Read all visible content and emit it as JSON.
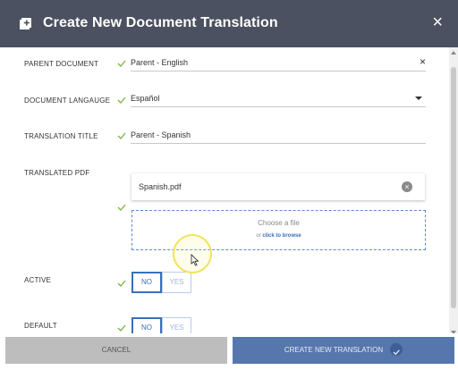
{
  "dialog": {
    "title": "Create New Document Translation",
    "close_label": "×"
  },
  "form": {
    "parent_document": {
      "label": "PARENT DOCUMENT",
      "value": "Parent - English",
      "clear": "×"
    },
    "document_language": {
      "label": "DOCUMENT LANGAUGE",
      "value": "Español"
    },
    "translation_title": {
      "label": "TRANSLATION TITLE",
      "value": "Parent - Spanish"
    },
    "translated_pdf": {
      "label": "TRANSLATED PDF",
      "file_name": "Spanish.pdf",
      "remove": "×",
      "drop_text": "Choose a file",
      "drop_or": "or ",
      "drop_browse": "click to browse"
    },
    "active": {
      "label": "ACTIVE",
      "options": [
        "NO",
        "YES"
      ],
      "selected": "NO"
    },
    "default": {
      "label": "DEFAULT",
      "options": [
        "NO",
        "YES"
      ],
      "selected": "NO"
    }
  },
  "footer": {
    "cancel_label": "CANCEL",
    "create_label": "CREATE NEW TRANSLATION"
  },
  "colors": {
    "header_bg": "#4b5160",
    "accent": "#3a6fb9",
    "check_green": "#7cb342",
    "create_button": "#5577ad",
    "cancel_button": "#bdbdbd"
  },
  "icons": {
    "header": "add-document-icon",
    "close": "close-icon",
    "valid": "checkmark-icon",
    "dropdown": "caret-down-icon",
    "remove_file": "remove-circle-icon",
    "create_confirm": "checkmark-circle-icon",
    "pointer": "mouse-cursor-icon"
  }
}
